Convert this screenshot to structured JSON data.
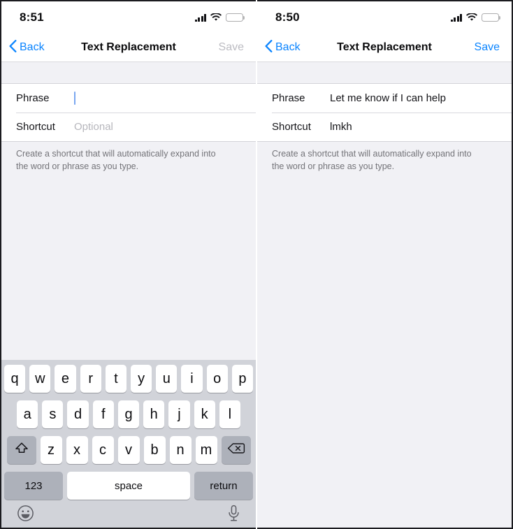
{
  "panels": [
    {
      "id": "left",
      "status": {
        "time": "8:51",
        "signal_bars": 4,
        "wifi": "wifi-icon",
        "battery": "battery-icon"
      },
      "nav": {
        "back_label": "Back",
        "title": "Text Replacement",
        "save_label": "Save",
        "save_enabled": false
      },
      "form": {
        "phrase_label": "Phrase",
        "phrase_value": "",
        "phrase_placeholder": "",
        "shortcut_label": "Shortcut",
        "shortcut_value": "",
        "shortcut_placeholder": "Optional"
      },
      "footnote": "Create a shortcut that will automatically expand into the word or phrase as you type.",
      "keyboard_visible": true
    },
    {
      "id": "right",
      "status": {
        "time": "8:50",
        "signal_bars": 3,
        "wifi": "wifi-icon",
        "battery": "battery-icon"
      },
      "nav": {
        "back_label": "Back",
        "title": "Text Replacement",
        "save_label": "Save",
        "save_enabled": true
      },
      "form": {
        "phrase_label": "Phrase",
        "phrase_value": "Let me know if I can help",
        "phrase_placeholder": "",
        "shortcut_label": "Shortcut",
        "shortcut_value": "lmkh",
        "shortcut_placeholder": "Optional"
      },
      "footnote": "Create a shortcut that will automatically expand into the word or phrase as you type.",
      "keyboard_visible": false
    }
  ],
  "keyboard": {
    "row1": [
      "q",
      "w",
      "e",
      "r",
      "t",
      "y",
      "u",
      "i",
      "o",
      "p"
    ],
    "row2": [
      "a",
      "s",
      "d",
      "f",
      "g",
      "h",
      "j",
      "k",
      "l"
    ],
    "row3": [
      "z",
      "x",
      "c",
      "v",
      "b",
      "n",
      "m"
    ],
    "shift_icon": "shift-icon",
    "delete_icon": "delete-icon",
    "numbers_label": "123",
    "space_label": "space",
    "return_label": "return",
    "emoji_icon": "emoji-icon",
    "dictation_icon": "microphone-icon"
  },
  "colors": {
    "accent": "#0a84ff",
    "disabled": "#bcbcc2",
    "keyboard_bg": "#d1d3d9",
    "key_bg": "#ffffff",
    "key_dark_bg": "#adb1ba",
    "group_bg": "#f1f1f5",
    "caret": "#7aa7f0"
  }
}
